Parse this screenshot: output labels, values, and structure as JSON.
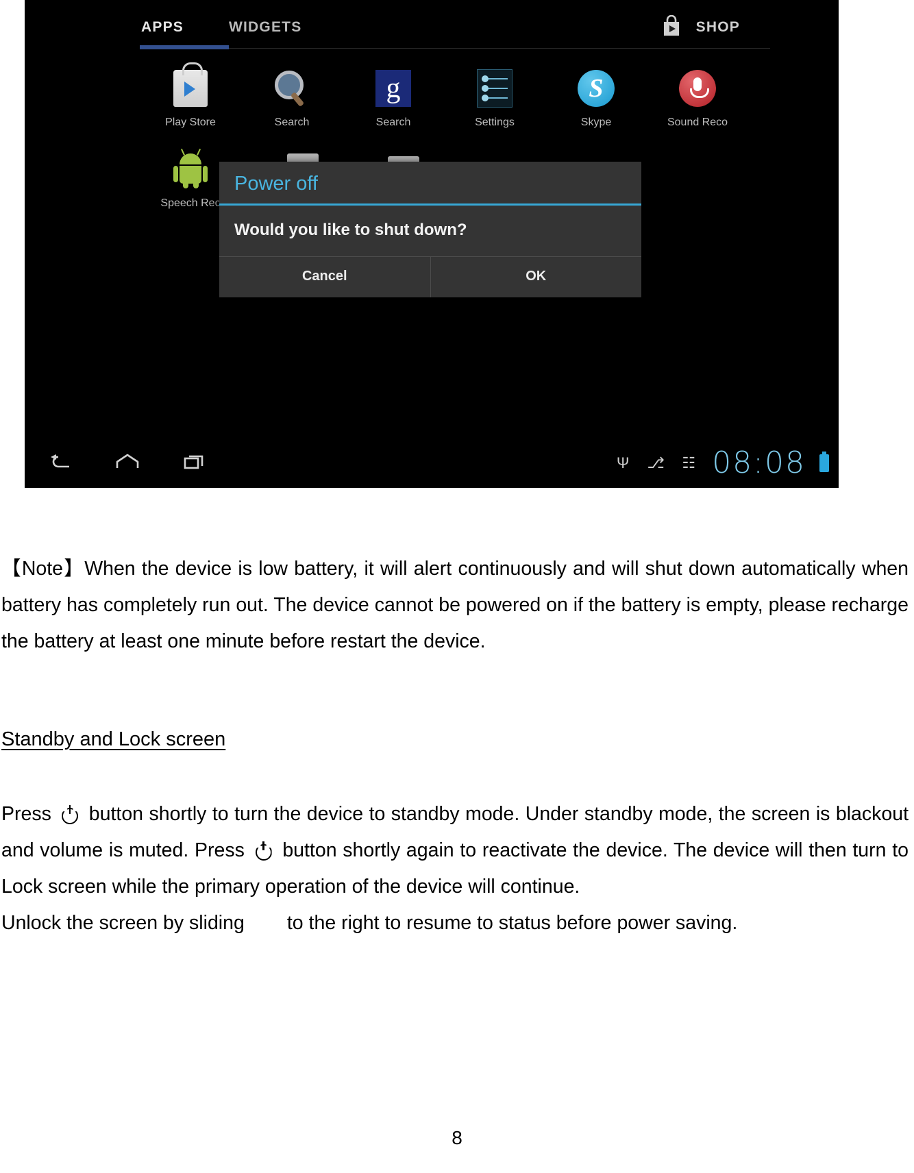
{
  "screenshot": {
    "tabs": [
      {
        "label": "APPS",
        "active": true
      },
      {
        "label": "WIDGETS",
        "active": false
      }
    ],
    "shop": {
      "label": "SHOP",
      "icon": "shop-bag-icon"
    },
    "accent_color": "#33508f",
    "apps": [
      {
        "label": "Play Store",
        "icon": "play-store-icon"
      },
      {
        "label": "Search",
        "icon": "magnifier-search-icon"
      },
      {
        "label": "Search",
        "icon": "google-search-icon"
      },
      {
        "label": "Settings",
        "icon": "settings-sliders-icon"
      },
      {
        "label": "Skype",
        "icon": "skype-icon"
      },
      {
        "label": "Sound Reco",
        "icon": "sound-recorder-icon"
      },
      {
        "label": "Speech Rec",
        "icon": "android-robot-icon"
      }
    ],
    "dialog": {
      "title": "Power off",
      "message": "Would you like to shut down?",
      "cancel_label": "Cancel",
      "ok_label": "OK",
      "title_color": "#49b5e0",
      "divider_color": "#37a8d6",
      "background_color": "#343434"
    },
    "systembar": {
      "nav": [
        {
          "name": "back-button",
          "glyph": "↩"
        },
        {
          "name": "home-button",
          "glyph": "⌂"
        },
        {
          "name": "recents-button",
          "glyph": "❐"
        }
      ],
      "status_icons": [
        {
          "name": "usb-icon",
          "glyph": "Ψ"
        },
        {
          "name": "sd-card-icon",
          "glyph": "⎇"
        },
        {
          "name": "notification-icon",
          "glyph": "☷"
        }
      ],
      "clock": "08:08",
      "clock_color": "#7ec9e8",
      "battery_icon": "battery-charging-icon"
    }
  },
  "document": {
    "note": {
      "marker_open": "【Note】",
      "text": "When the device is low battery, it will alert continuously and will shut down automatically when battery has completely run out.   The device cannot be powered on if the battery is empty, please recharge the battery at least one minute before restart the device."
    },
    "heading": "Standby and Lock screen",
    "standby": {
      "part1": "Press",
      "part2": "button shortly to turn the device to standby mode.   Under standby mode, the screen is blackout and volume is muted.",
      "part3": "Press",
      "part4": "button shortly again to reactivate the device.    The device will then turn to Lock screen while the primary operation of the device will continue.",
      "power_icon": "power-button-icon"
    },
    "unlock": {
      "part1": "Unlock the screen by sliding",
      "part2": "to the right to resume to status before power saving."
    },
    "page_number": "8"
  }
}
